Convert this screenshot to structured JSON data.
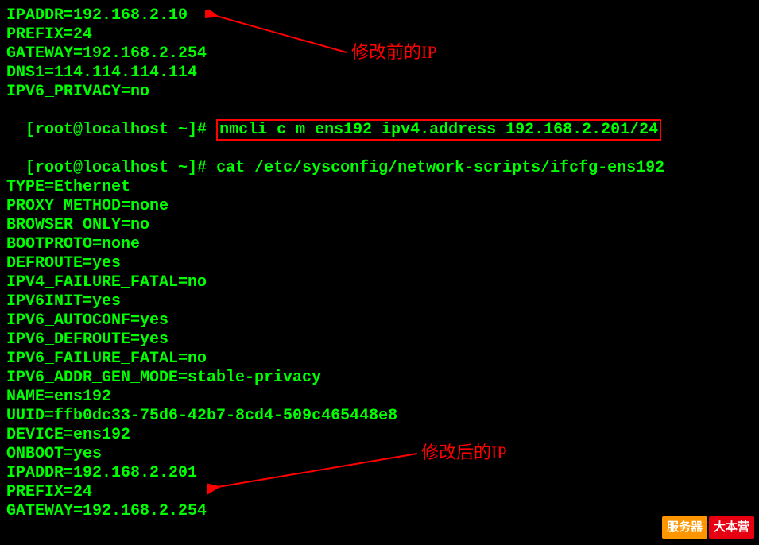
{
  "annotations": {
    "before": "修改前的IP",
    "after": "修改后的IP"
  },
  "watermark": {
    "left": "服务器",
    "right": "大本营"
  },
  "prompt": "[root@localhost ~]# ",
  "commands": {
    "nmcli": "nmcli c m ens192 ipv4.address 192.168.2.201/24",
    "cat": "cat /etc/sysconfig/network-scripts/ifcfg-ens192"
  },
  "before_lines": [
    "IPADDR=192.168.2.10",
    "PREFIX=24",
    "GATEWAY=192.168.2.254",
    "DNS1=114.114.114.114",
    "IPV6_PRIVACY=no"
  ],
  "after_lines": [
    "TYPE=Ethernet",
    "PROXY_METHOD=none",
    "BROWSER_ONLY=no",
    "BOOTPROTO=none",
    "DEFROUTE=yes",
    "IPV4_FAILURE_FATAL=no",
    "IPV6INIT=yes",
    "IPV6_AUTOCONF=yes",
    "IPV6_DEFROUTE=yes",
    "IPV6_FAILURE_FATAL=no",
    "IPV6_ADDR_GEN_MODE=stable-privacy",
    "NAME=ens192",
    "UUID=ffb0dc33-75d6-42b7-8cd4-509c465448e8",
    "DEVICE=ens192",
    "ONBOOT=yes",
    "IPADDR=192.168.2.201",
    "PREFIX=24",
    "GATEWAY=192.168.2.254"
  ]
}
